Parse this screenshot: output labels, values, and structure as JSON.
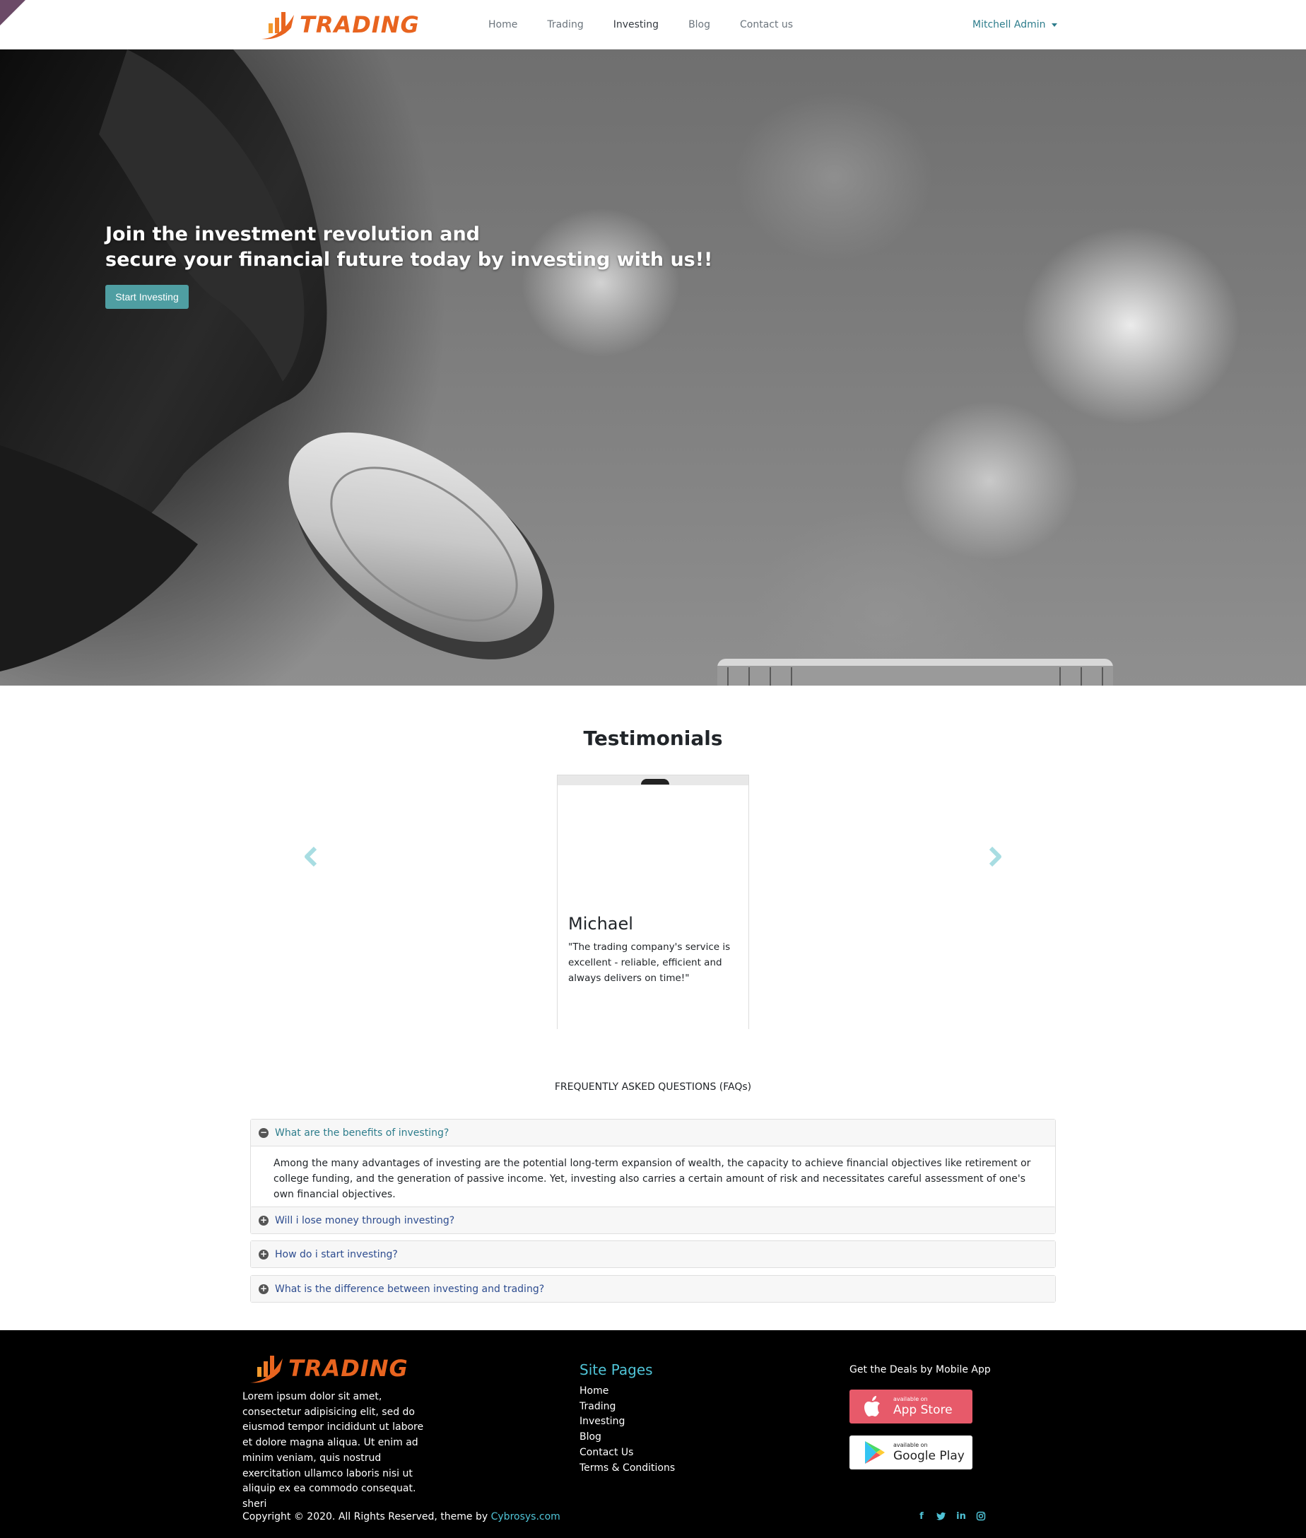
{
  "header": {
    "logo_text": "TRADING",
    "nav": [
      {
        "label": "Home"
      },
      {
        "label": "Trading"
      },
      {
        "label": "Investing"
      },
      {
        "label": "Blog"
      },
      {
        "label": "Contact us"
      }
    ],
    "active_nav": "Investing",
    "user": "Mitchell Admin"
  },
  "hero": {
    "title_line1": "Join the investment revolution and",
    "title_line2": "secure your financial future today by investing with us!!",
    "button": "Start Investing"
  },
  "testimonials": {
    "title": "Testimonials",
    "card": {
      "name": "Michael",
      "quote": "\"The trading company's service is excellent - reliable, efficient and always delivers on time!\""
    }
  },
  "faq": {
    "title": "FREQUENTLY ASKED QUESTIONS (FAQs)",
    "items": [
      {
        "question": "What are the benefits of investing?",
        "answer": "Among the many advantages of investing are the potential long-term expansion of wealth, the capacity to achieve financial objectives like retirement or college funding, and the generation of passive income. Yet, investing also carries a certain amount of risk and necessitates careful assessment of one's own financial objectives.",
        "expanded": true
      },
      {
        "question": "Will i lose money through investing?",
        "expanded": false
      },
      {
        "question": "How do i start investing?",
        "expanded": false
      },
      {
        "question": "What is the difference between investing and trading?",
        "expanded": false
      }
    ]
  },
  "footer": {
    "logo_text": "TRADING",
    "about": "Lorem ipsum dolor sit amet, consectetur adipisicing elit, sed do eiusmod tempor incididunt ut labore et dolore magna aliqua. Ut enim ad minim veniam, quis nostrud exercitation ullamco laboris nisi ut aliquip ex ea commodo consequat. sheri",
    "site_pages_title": "Site Pages",
    "links": [
      {
        "label": "Home"
      },
      {
        "label": "Trading"
      },
      {
        "label": "Investing"
      },
      {
        "label": "Blog"
      },
      {
        "label": "Contact Us"
      },
      {
        "label": "Terms & Conditions"
      }
    ],
    "app_title": "Get the Deals by Mobile App",
    "app_store": {
      "small": "available on",
      "big": "App Store"
    },
    "google_play": {
      "small": "available on",
      "big": "Google Play"
    },
    "copyright_prefix": "Copyright © 2020. All Rights Reserved, theme by ",
    "copyright_link": "Cybrosys.com",
    "socials": [
      "facebook-icon",
      "twitter-icon",
      "linkedin-icon",
      "instagram-icon"
    ]
  },
  "colors": {
    "brand_orange": "#e8641f",
    "teal_button": "#4f9ea2",
    "link_cyan": "#4fc3d6",
    "app_store_red": "#e75a6a"
  }
}
